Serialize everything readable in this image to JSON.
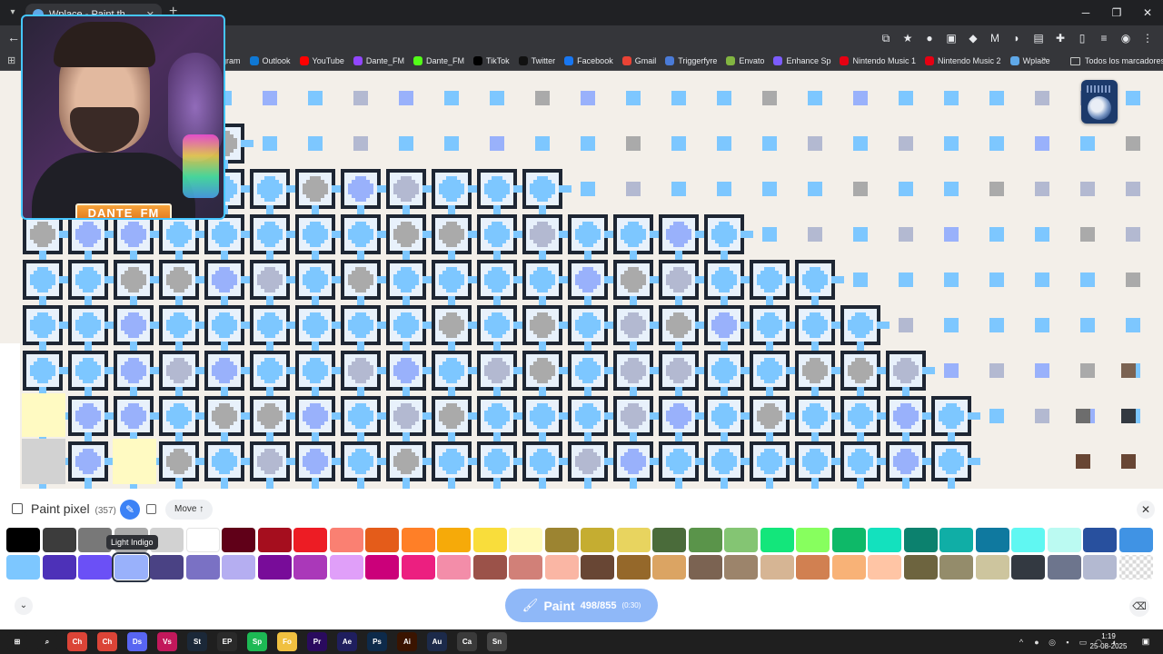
{
  "browser": {
    "tab_title": "Wplace - Paint the world",
    "tab_close": "✕",
    "new_tab": "+",
    "window_controls": [
      "─",
      "❐",
      "✕"
    ]
  },
  "bookmarks": {
    "items": [
      {
        "label": "gram",
        "color": "#c13584"
      },
      {
        "label": "Outlook",
        "color": "#0f78d4"
      },
      {
        "label": "YouTube",
        "color": "#ff0000"
      },
      {
        "label": "Dante_FM",
        "color": "#9146ff"
      },
      {
        "label": "Dante_FM",
        "color": "#53fc18"
      },
      {
        "label": "TikTok",
        "color": "#000000"
      },
      {
        "label": "Twitter",
        "color": "#111111"
      },
      {
        "label": "Facebook",
        "color": "#1877f2"
      },
      {
        "label": "Gmail",
        "color": "#ea4335"
      },
      {
        "label": "Triggerfyre",
        "color": "#4a7bd8"
      },
      {
        "label": "Envato",
        "color": "#82b541"
      },
      {
        "label": "Enhance Sp",
        "color": "#7c5cff"
      },
      {
        "label": "Nintendo Music 1",
        "color": "#e60012"
      },
      {
        "label": "Nintendo Music 2",
        "color": "#e60012"
      },
      {
        "label": "Wplace",
        "color": "#5fa8e8"
      }
    ],
    "all_bookmarks": "Todos los marcadores"
  },
  "webcam": {
    "name_badge": "DANTE_FM"
  },
  "panel": {
    "title": "Paint pixel",
    "count": "(357)",
    "move_label": "Move ↑",
    "tooltip": "Light Indigo",
    "paint_label": "Paint",
    "paint_charges": "498/855",
    "paint_timer": "(0:30)"
  },
  "palette": {
    "row1": [
      "#000000",
      "#3c3c3c",
      "#787878",
      "#aaaaaa",
      "#d2d2d2",
      "#ffffff",
      "#600018",
      "#a50e1e",
      "#ed1c24",
      "#fa8072",
      "#e45c1a",
      "#ff7f27",
      "#f6aa09",
      "#f9dd3b",
      "#fffabc",
      "#9c8431",
      "#c5ad31",
      "#e8d45f",
      "#4a6b3a",
      "#5a944a",
      "#84c573",
      "#13e67b",
      "#87ff5e",
      "#0eb968",
      "#13e1be",
      "#0c816e",
      "#10aea6",
      "#0f799f",
      "#60f7f2",
      "#bbfaf2",
      "#28509e",
      "#4093e4"
    ],
    "row2": [
      "#7dc7ff",
      "#4d31b8",
      "#6b50f6",
      "#99b1fb",
      "#4a4284",
      "#7a71c4",
      "#b5aef1",
      "#780c99",
      "#aa38b9",
      "#e09ff9",
      "#cb007a",
      "#ec1f80",
      "#f38da9",
      "#9b5249",
      "#d18078",
      "#fab6a4",
      "#684634",
      "#95682a",
      "#dba463",
      "#7b6352",
      "#9c846b",
      "#d6b594",
      "#d18051",
      "#f8b277",
      "#ffc5a5",
      "#6d643f",
      "#948c6b",
      "#cdc59e",
      "#333941",
      "#6d758d",
      "#b3b9d1",
      "checker"
    ],
    "selected_row": 2,
    "selected_index": 3
  },
  "taskbar": {
    "apps": [
      "⊞",
      "⌕",
      "Ch",
      "Ch",
      "Ds",
      "Vs",
      "St",
      "EP",
      "Sp",
      "Fo",
      "Pr",
      "Ae",
      "Ps",
      "Ai",
      "Au",
      "Ca",
      "Sn"
    ],
    "time": "1:19",
    "date": "25-08-2025"
  }
}
